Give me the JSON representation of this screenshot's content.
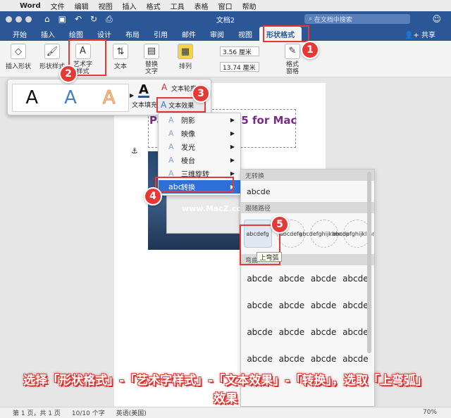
{
  "menubar": {
    "apple": "",
    "items": [
      "Word",
      "文件",
      "编辑",
      "视图",
      "插入",
      "格式",
      "工具",
      "表格",
      "窗口",
      "帮助"
    ]
  },
  "titlebar": {
    "title": "文档2",
    "search_placeholder": "在文档中搜索",
    "icons": [
      "home-icon",
      "save-icon",
      "undo-icon",
      "redo-icon",
      "print-icon"
    ]
  },
  "tabs": [
    "开始",
    "插入",
    "绘图",
    "设计",
    "布局",
    "引用",
    "邮件",
    "审阅",
    "视图",
    "形状格式"
  ],
  "active_tab": "形状格式",
  "share_label": "共享",
  "ribbon": {
    "insert_shape": "插入形状",
    "shape_styles": "形状样式",
    "wordart_styles": "艺术字\n样式",
    "text": "文本",
    "alt_text": "替换\n文字",
    "arrange": "排列",
    "height": "3.56 厘米",
    "width": "13.74 厘米",
    "format_pane": "格式\n窗格"
  },
  "wordart_popup": {
    "samples": [
      "A",
      "A",
      "A"
    ],
    "fill_label": "文本填充",
    "outline_label": "文本轮廓"
  },
  "effects_button": "文本效果",
  "effects_menu": [
    {
      "label": "阴影",
      "arrow": "▶"
    },
    {
      "label": "映像",
      "arrow": "▶"
    },
    {
      "label": "发光",
      "arrow": "▶"
    },
    {
      "label": "棱台",
      "arrow": "▶"
    },
    {
      "label": "三维旋转",
      "arrow": "▶"
    },
    {
      "label": "转换",
      "arrow": "▶"
    }
  ],
  "document": {
    "wordart_line1": "Pa                   15 for Mac",
    "wordart_line2": "                  4)",
    "watermark": "www.MacZ.com"
  },
  "transform_menu": {
    "no_transform": "无转换",
    "plain_sample": "abcde",
    "follow_path": "跟随路径",
    "path_samples": [
      "abcdefg",
      "abcdefg",
      "abcdefghijklmnop",
      "abcdefghijklmnop"
    ],
    "warp": "弯曲",
    "warp_samples": [
      "abcde",
      "abcde",
      "abcde",
      "abcde",
      "abcde",
      "abcde",
      "abcde",
      "abcde",
      "abcde",
      "abcde",
      "abcde",
      "abcde",
      "abcde",
      "abcde",
      "abcde",
      "abcde"
    ],
    "tooltip": "上弯弧"
  },
  "callouts": [
    "1",
    "2",
    "3",
    "4",
    "5"
  ],
  "caption": {
    "line1": "选择「形状格式」-「艺术字样式」-「文本效果」-「转换」，选取「上弯弧」",
    "line2": "效果"
  },
  "statusbar": {
    "page": "第 1 页，共 1 页",
    "words": "10/10 个字",
    "lang": "英语(美国)",
    "zoom": "70%"
  }
}
